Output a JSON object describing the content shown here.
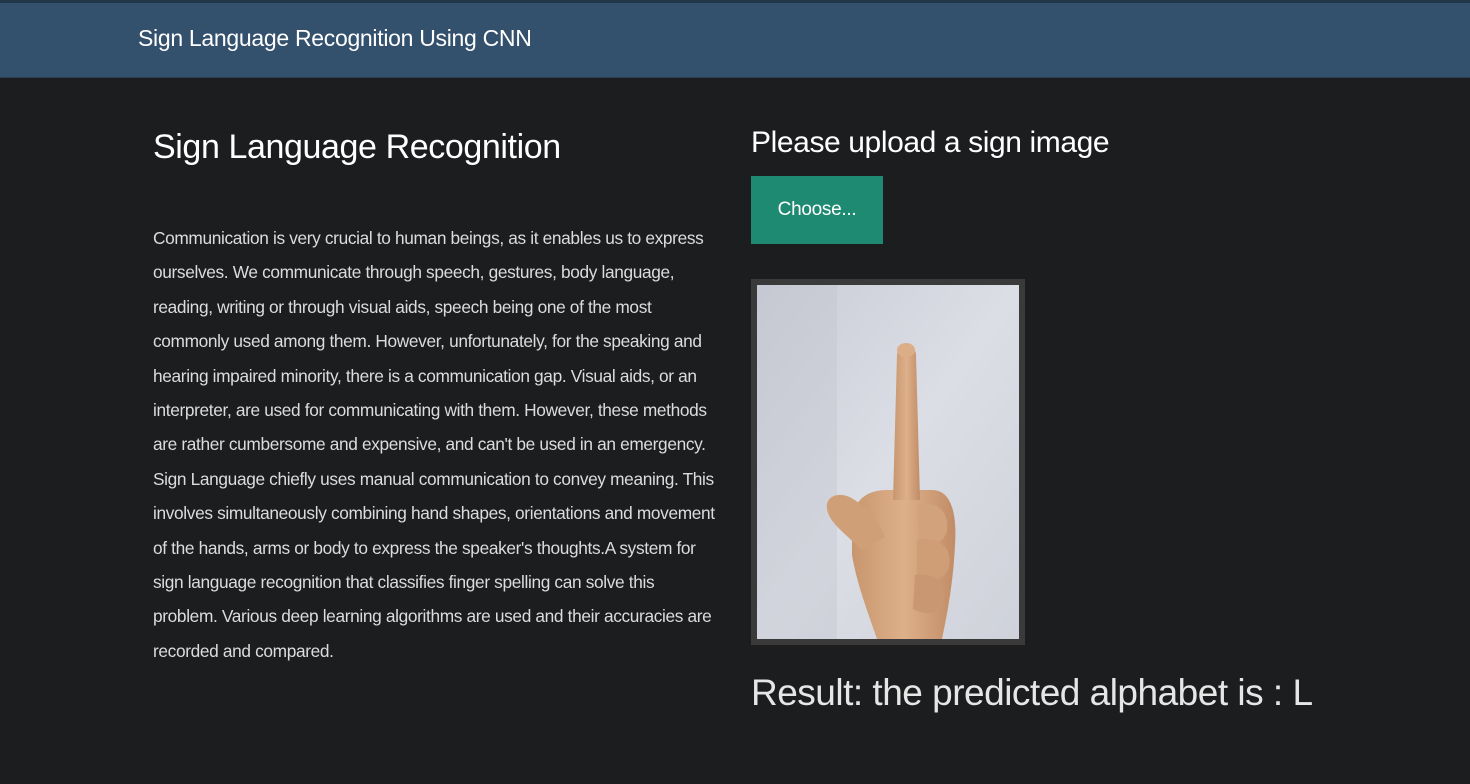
{
  "navbar": {
    "brand": "Sign Language Recognition Using CNN"
  },
  "intro": {
    "title": "Sign Language Recognition",
    "description": "Communication is very crucial to human beings, as it enables us to express ourselves. We communicate through speech, gestures, body language, reading, writing or through visual aids, speech being one of the most commonly used among them. However, unfortunately, for the speaking and hearing impaired minority, there is a communication gap. Visual aids, or an interpreter, are used for communicating with them. However, these methods are rather cumbersome and expensive, and can't be used in an emergency. Sign Language chiefly uses manual communication to convey meaning. This involves simultaneously combining hand shapes, orientations and movement of the hands, arms or body to express the speaker's thoughts.A system for sign language recognition that classifies finger spelling can solve this problem. Various deep learning algorithms are used and their accuracies are recorded and compared."
  },
  "upload": {
    "heading": "Please upload a sign image",
    "button_label": "Choose...",
    "preview_icon": "hand-sign-L-image"
  },
  "result": {
    "text": "Result: the predicted alphabet is : L"
  },
  "colors": {
    "navbar": "#33506d",
    "background": "#1b1d1f",
    "button": "#1e8a72"
  }
}
